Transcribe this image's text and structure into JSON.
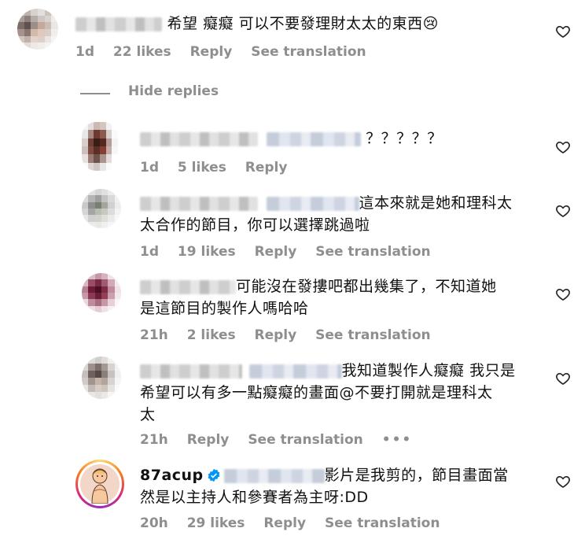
{
  "comments": [
    {
      "text": "希望 癡癡 可以不要發理財太太的東西",
      "emoji": "😢",
      "time": "1d",
      "likes": "22 likes",
      "reply": "Reply",
      "translate": "See translation"
    }
  ],
  "hide_replies": "Hide replies",
  "replies": [
    {
      "text": "？？？？？",
      "time": "1d",
      "likes": "5 likes",
      "reply": "Reply"
    },
    {
      "text_line1": "這本來就是她和理科太",
      "text_line2": "太合作的節目，你可以選擇跳過啦",
      "time": "1d",
      "likes": "19 likes",
      "reply": "Reply",
      "translate": "See translation"
    },
    {
      "text_line1": "可能沒在發摟吧都出幾集了，不知道她",
      "text_line2": "是這節目的製作人嗎哈哈",
      "time": "21h",
      "likes": "2 likes",
      "reply": "Reply",
      "translate": "See translation"
    },
    {
      "text_line1": "我知道製作人癡癡 我只是",
      "text_line2": "希望可以有多一點癡癡的畫面@不要打開就是理科太",
      "text_line3": "太",
      "time": "21h",
      "reply": "Reply",
      "translate": "See translation",
      "more": "•••"
    },
    {
      "username": "87acup",
      "text_line1": "影片是我剪的，節目畫面當",
      "text_line2": "然是以主持人和參賽者為主呀:DD",
      "time": "20h",
      "likes": "29 likes",
      "reply": "Reply",
      "translate": "See translation"
    }
  ],
  "icons": {
    "like": "heart-outline-icon",
    "verified": "verified-badge-icon"
  },
  "colors": {
    "meta": "#8e8e8e",
    "verified": "#0095f6",
    "story_ring": "#d62976"
  }
}
